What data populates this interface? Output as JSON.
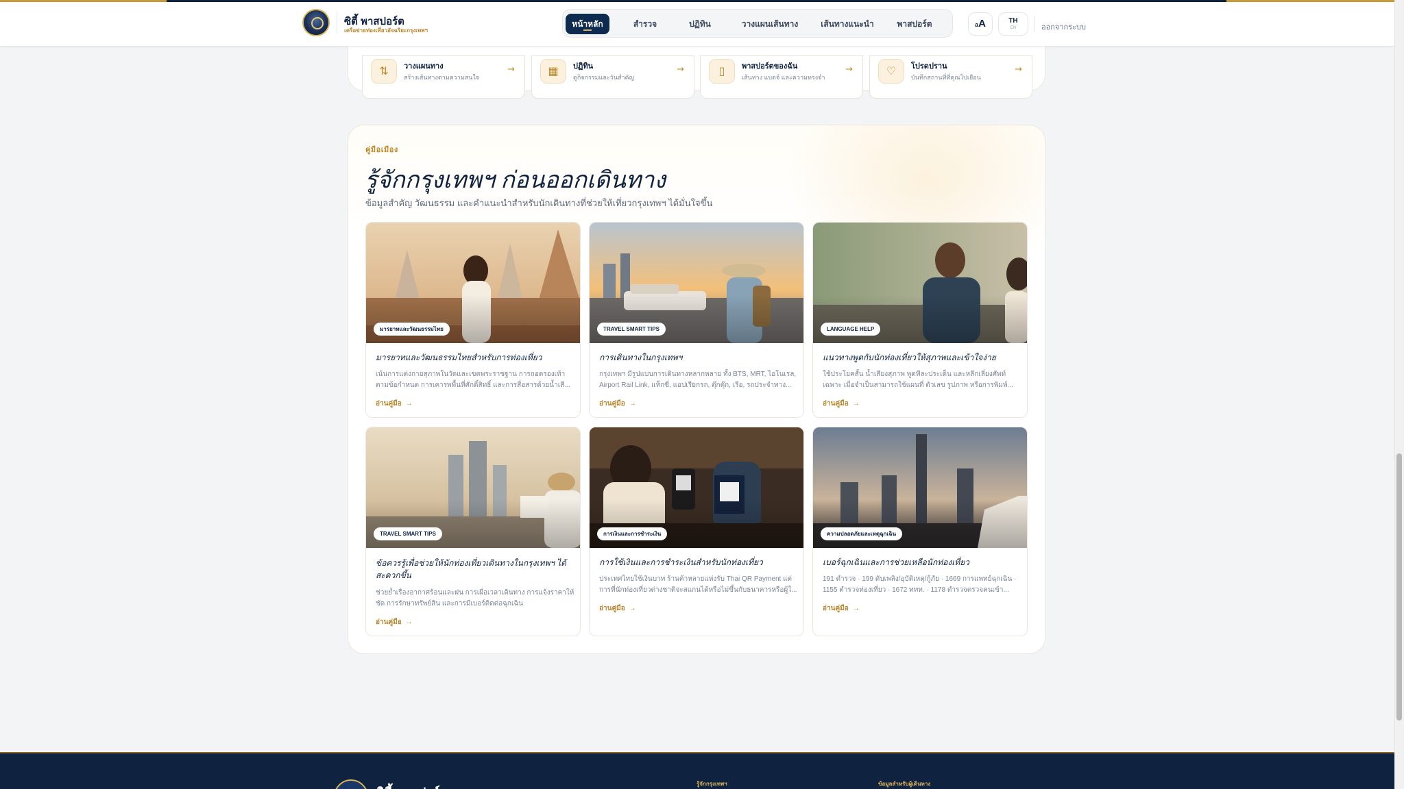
{
  "header": {
    "brand_name": "ซิตี้ พาสปอร์ต",
    "brand_tagline": "เครือข่ายท่องเที่ยวอัจฉริยะกรุงเทพฯ",
    "nav": [
      {
        "label": "หน้าหลัก",
        "active": true
      },
      {
        "label": "สำรวจ",
        "active": false
      },
      {
        "label": "ปฏิทิน",
        "active": false
      },
      {
        "label": "วางแผนเส้นทาง",
        "active": false
      },
      {
        "label": "เส้นทางแนะนำ",
        "active": false
      },
      {
        "label": "พาสปอร์ต",
        "active": false
      }
    ],
    "font_size_label": "A",
    "font_size_small": "a",
    "lang_primary": "TH",
    "lang_secondary": "EN",
    "logout_label": "ออกจากระบบ"
  },
  "quick_cards": [
    {
      "icon": "sliders-icon",
      "title": "วางแผนทาง",
      "desc": "สร้างเส้นทางตามความสนใจ"
    },
    {
      "icon": "calendar-icon",
      "title": "ปฏิทิน",
      "desc": "ดูกิจกรรมและวันสำคัญ"
    },
    {
      "icon": "book-icon",
      "title": "พาสปอร์ตของฉัน",
      "desc": "เส้นทาง แบดจ์ และความทรงจำ"
    },
    {
      "icon": "heart-shield-icon",
      "title": "โปรดปราน",
      "desc": "บันทึกสถานที่ที่คุณไปเยือน"
    }
  ],
  "guide": {
    "eyebrow": "คู่มือเมือง",
    "title": "รู้จักกรุงเทพฯ ก่อนออกเดินทาง",
    "subtitle": "ข้อมูลสำคัญ วัฒนธรรม และคำแนะนำสำหรับนักเดินทางที่ช่วยให้เที่ยวกรุงเทพฯ ได้มั่นใจขึ้น",
    "read_label": "อ่านคู่มือ",
    "cards": [
      {
        "tag": "มารยาทและวัฒนธรรมไทย",
        "title": "มารยาทและวัฒนธรรมไทยสำหรับการท่องเที่ยว",
        "desc": "เน้นการแต่งกายสุภาพในวัดและเขตพระราชฐาน การถอดรองเท้า ตามข้อกำหนด การเคารพพื้นที่ศักดิ์สิทธิ์ และการสื่อสารด้วยน้ำเสี..."
      },
      {
        "tag": "TRAVEL SMART TIPS",
        "title": "การเดินทางในกรุงเทพฯ",
        "desc": "กรุงเทพฯ มีรูปแบบการเดินทางหลากหลาย ทั้ง BTS, MRT, ไอโนเรล, Airport Rail Link, แท็กซี่, แอปเรียกรถ, ตุ๊กตุ๊ก, เรือ, รถประจำทาง..."
      },
      {
        "tag": "LANGUAGE HELP",
        "title": "แนวทางพูดกับนักท่องเที่ยวให้สุภาพและเข้าใจง่าย",
        "desc": "ใช้ประโยคสั้น น้ำเสียงสุภาพ พูดทีละประเด็น และหลีกเลี่ยงศัพท์เฉพาะ เมื่อจำเป็นสามารถใช้แผนที่ ตัวเลข รูปภาพ หรือการพิมพ์..."
      },
      {
        "tag": "TRAVEL SMART TIPS",
        "title": "ข้อควรรู้เพื่อช่วยให้นักท่องเที่ยวเดินทางในกรุงเทพฯ ได้สะดวกขึ้น",
        "desc": "ช่วยย้ำเรื่องอากาศร้อนและฝน การเผื่อเวลาเดินทาง การแจ้งราคาให้ชัด การรักษาทรัพย์สิน และการมีเบอร์ติดต่อฉุกเฉิน"
      },
      {
        "tag": "การเงินและการชำระเงิน",
        "title": "การใช้เงินและการชำระเงินสำหรับนักท่องเที่ยว",
        "desc": "ประเทศไทยใช้เงินบาท ร้านค้าหลายแห่งรับ Thai QR Payment แต่การที่นักท่องเที่ยวต่างชาติจะสแกนได้หรือไม่ขึ้นกับธนาคารหรือผู้ใ..."
      },
      {
        "tag": "ความปลอดภัยและเหตุฉุกเฉิน",
        "title": "เบอร์ฉุกเฉินและการช่วยเหลือนักท่องเที่ยว",
        "desc": "191 ตำรวจ · 199 ดับเพลิง/อุบัติเหตุ/กู้ภัย · 1669 การแพทย์ฉุกเฉิน · 1155 ตำรวจท่องเที่ยว · 1672 ททท. · 1178 ตำรวจตรวจคนเข้า..."
      }
    ]
  },
  "footer": {
    "brand": "ซิตี้ พาสปอร์ต",
    "col1_title": "รู้จักกรุงเทพฯ",
    "col2_title": "ข้อมูลสำหรับผู้เดินทาง"
  },
  "colors": {
    "navy": "#0f2340",
    "gold": "#c99a3a",
    "background": "#f3f4f6"
  }
}
